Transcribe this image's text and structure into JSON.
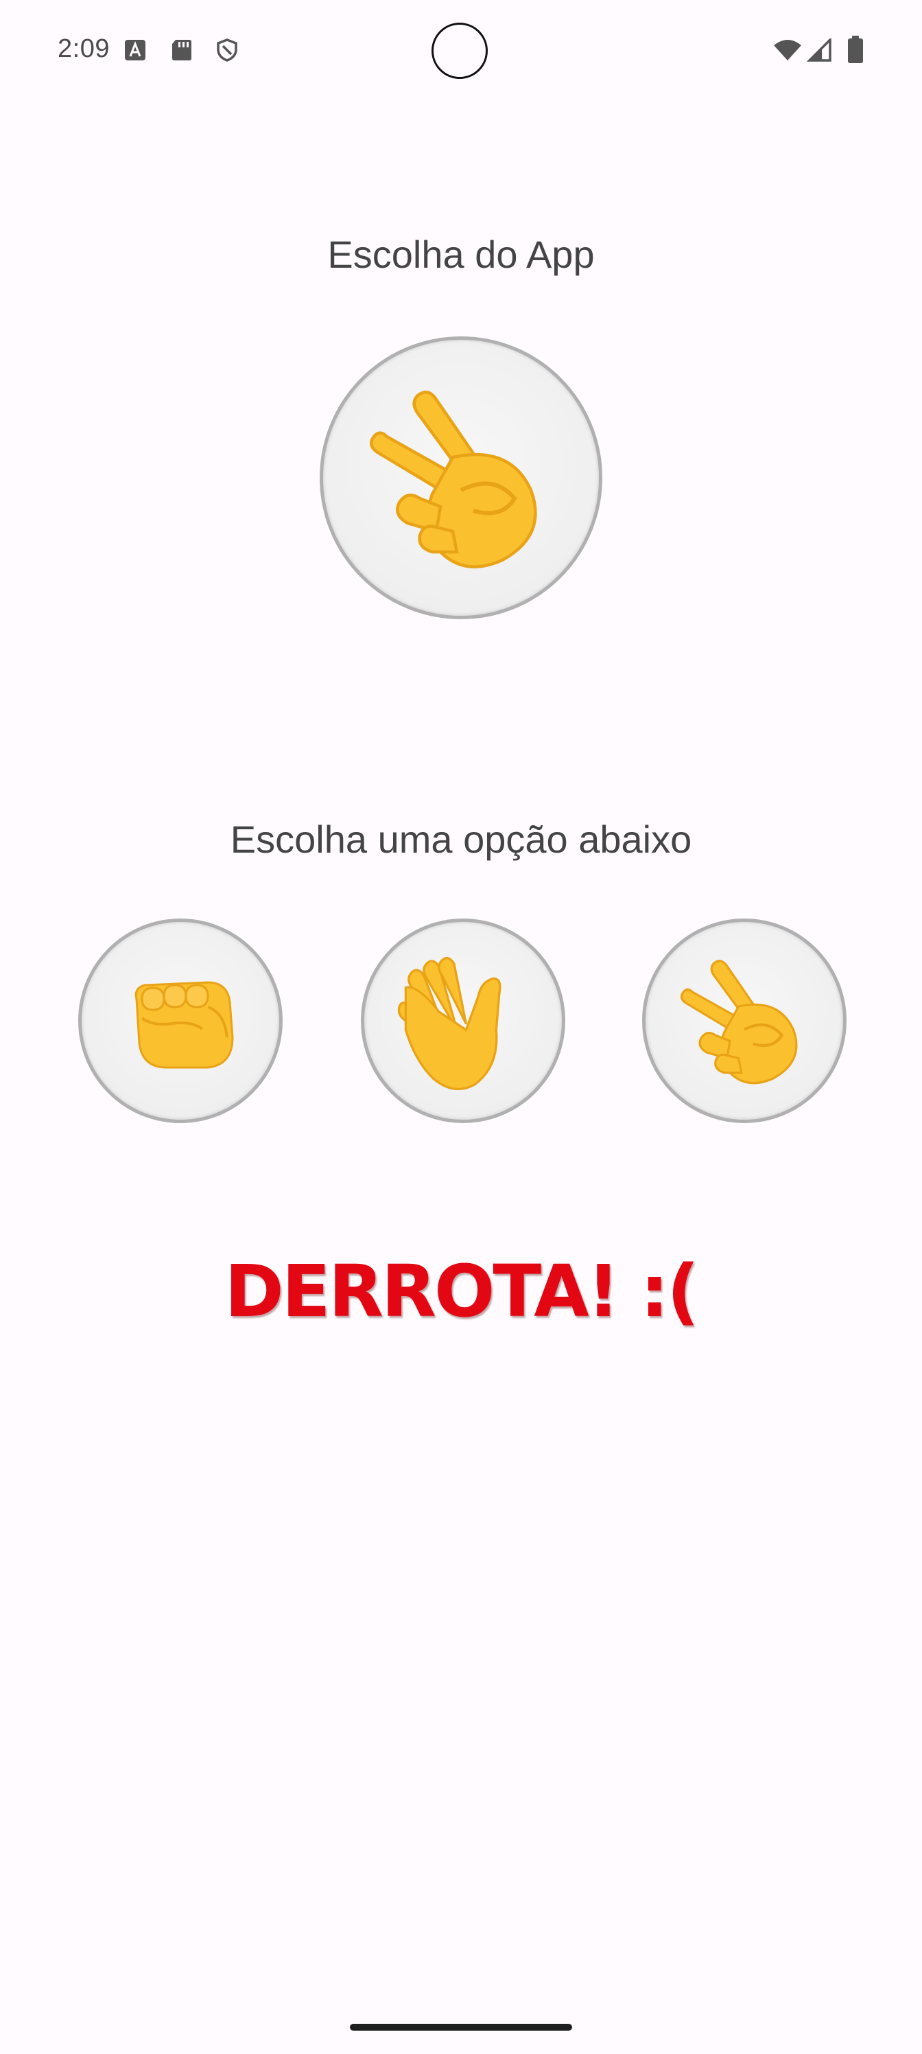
{
  "status_bar": {
    "time": "2:09"
  },
  "app_choice": {
    "title": "Escolha do App",
    "selected_icon": "victory-hand-icon"
  },
  "user_choice": {
    "title": "Escolha uma opção abaixo",
    "options": [
      {
        "icon": "fist-icon"
      },
      {
        "icon": "open-hand-icon"
      },
      {
        "icon": "victory-hand-icon"
      }
    ]
  },
  "result": {
    "text": "DERROTA! :(",
    "color": "#e30613"
  },
  "colors": {
    "background": "#fffbfe",
    "emoji_yellow": "#fbc02d",
    "emoji_shade": "#e8a317"
  }
}
